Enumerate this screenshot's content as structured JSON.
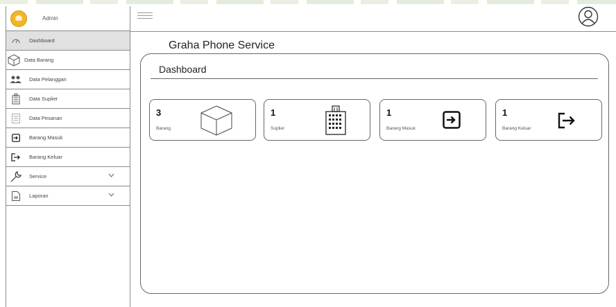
{
  "sidebar": {
    "user_name": "Admin",
    "items": [
      {
        "label": "Dashboard",
        "icon": "dashboard-gauge-icon",
        "active": true
      },
      {
        "label": "Data Barang",
        "icon": "box-icon"
      },
      {
        "label": "Data Pelanggan",
        "icon": "users-icon"
      },
      {
        "label": "Data Suplier",
        "icon": "building-icon"
      },
      {
        "label": "Data Pesanan",
        "icon": "list-icon"
      },
      {
        "label": "Barang Masuk",
        "icon": "sign-in-icon"
      },
      {
        "label": "Barang Keluar",
        "icon": "sign-out-icon"
      },
      {
        "label": "Service",
        "icon": "wrench-icon",
        "expandable": true
      },
      {
        "label": "Laporan",
        "icon": "document-icon",
        "expandable": true
      }
    ]
  },
  "header": {
    "menu_icon": "hamburger-icon",
    "user_icon": "user-circle-icon"
  },
  "main": {
    "app_title": "Graha Phone Service",
    "panel_title": "Dashboard",
    "cards": [
      {
        "value": "3",
        "label": "Barang",
        "icon": "box-icon"
      },
      {
        "value": "1",
        "label": "Suplier",
        "icon": "building-icon"
      },
      {
        "value": "1",
        "label": "Barang Masuk",
        "icon": "sign-in-icon"
      },
      {
        "value": "1",
        "label": "Barang Keluar",
        "icon": "sign-out-icon"
      }
    ]
  },
  "colors": {
    "avatar": "#f0b62a",
    "active_item": "#e1e1e1",
    "border": "#8a8a8a"
  }
}
